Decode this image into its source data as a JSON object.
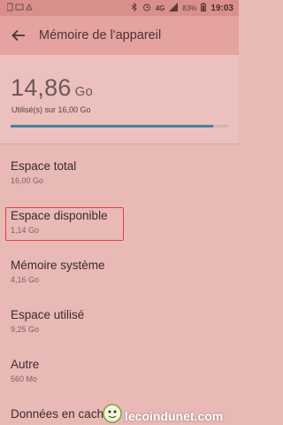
{
  "status_bar": {
    "network": "4G",
    "battery": "83%",
    "time": "19:03"
  },
  "app_bar": {
    "title": "Mémoire de l'appareil"
  },
  "summary": {
    "used_value": "14,86",
    "used_unit": "Go",
    "subtitle": "Utilisé(s) sur 16,00 Go",
    "usage_fraction": 0.929
  },
  "items": [
    {
      "label": "Espace total",
      "value": "16,00 Go"
    },
    {
      "label": "Espace disponible",
      "value": "1,14 Go"
    },
    {
      "label": "Mémoire système",
      "value": "4,16 Go"
    },
    {
      "label": "Espace utilisé",
      "value": "9,25 Go"
    },
    {
      "label": "Autre",
      "value": "560 Mo"
    },
    {
      "label": "Données en cache",
      "value": ""
    }
  ],
  "watermark": {
    "text": "lecoindunet.com"
  },
  "colors": {
    "progress": "#4c7f9b",
    "highlight": "#e04040"
  }
}
